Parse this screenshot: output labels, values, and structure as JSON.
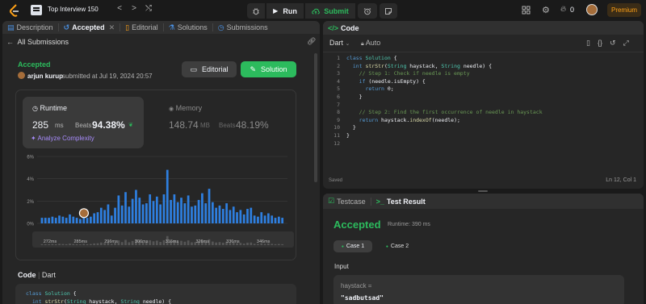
{
  "topbar": {
    "title": "Top Interview 150",
    "prev": "<",
    "next": ">",
    "shuffle": "⤭",
    "run": "Run",
    "submit": "Submit",
    "premium": "Premium",
    "fire_count": "0"
  },
  "left": {
    "tabs": [
      {
        "label": "Description"
      },
      {
        "label": "Accepted"
      },
      {
        "label": "Editorial"
      },
      {
        "label": "Solutions"
      },
      {
        "label": "Submissions"
      }
    ],
    "back": "All Submissions",
    "status": "Accepted",
    "user": "arjun kurup",
    "submitted": "submitted at Jul 19, 2024 20:57",
    "editorial_btn": "Editorial",
    "solution_btn": "Solution",
    "runtime": {
      "label": "Runtime",
      "value": "285",
      "unit": "ms",
      "beats": "Beats",
      "pct": "94.38%",
      "analyze": "Analyze Complexity"
    },
    "memory": {
      "label": "Memory",
      "value": "148.74",
      "unit": "MB",
      "beats": "Beats",
      "pct": "48.19%"
    },
    "code_label": "Code",
    "lang": "Dart",
    "code_preview": [
      "class Solution {",
      "  int strStr(String haystack, String needle) {"
    ]
  },
  "chart_data": {
    "type": "bar",
    "yticks": [
      "6%",
      "4%",
      "2%",
      "0%"
    ],
    "ylim": [
      0,
      6
    ],
    "x": [
      "272ms",
      "285ms",
      "296ms",
      "306ms",
      "316ms",
      "326ms",
      "336ms",
      "346ms"
    ],
    "values": [
      0.5,
      0.5,
      0.5,
      0.6,
      0.5,
      0.7,
      0.6,
      0.5,
      0.8,
      0.6,
      0.5,
      0.4,
      0.7,
      0.5,
      0.6,
      0.9,
      1.0,
      1.4,
      1.2,
      1.7,
      0.7,
      1.4,
      2.5,
      1.6,
      2.8,
      1.5,
      2.2,
      3.0,
      2.3,
      1.7,
      1.8,
      2.6,
      2.0,
      2.4,
      1.7,
      2.6,
      4.8,
      2.1,
      2.6,
      1.9,
      2.3,
      1.8,
      2.5,
      1.5,
      1.6,
      2.1,
      2.7,
      1.8,
      3.1,
      1.9,
      1.4,
      1.6,
      1.3,
      1.8,
      1.2,
      1.5,
      1.0,
      1.2,
      0.8,
      1.3,
      1.4,
      0.7,
      0.6,
      1.0,
      0.7,
      0.9,
      0.7,
      0.5,
      0.6,
      0.5
    ],
    "highlight_index": 12
  },
  "code": {
    "header": "Code",
    "lang": "Dart",
    "mode": "Auto",
    "saved": "Saved",
    "cursor": "Ln 12, Col 1",
    "lines": [
      [
        {
          "t": "class ",
          "c": "kw"
        },
        {
          "t": "Solution",
          "c": "ty"
        },
        {
          "t": " {",
          "c": ""
        }
      ],
      [
        {
          "t": "  int ",
          "c": "kw"
        },
        {
          "t": "strStr",
          "c": "fn"
        },
        {
          "t": "(",
          "c": ""
        },
        {
          "t": "String",
          "c": "ty"
        },
        {
          "t": " haystack, ",
          "c": ""
        },
        {
          "t": "String",
          "c": "ty"
        },
        {
          "t": " needle) {",
          "c": ""
        }
      ],
      [
        {
          "t": "    // Step 1: Check if needle is empty",
          "c": "cm"
        }
      ],
      [
        {
          "t": "    if",
          "c": "kw"
        },
        {
          "t": " (needle.isEmpty) {",
          "c": ""
        }
      ],
      [
        {
          "t": "      return",
          "c": "kw"
        },
        {
          "t": " 0;",
          "c": ""
        }
      ],
      [
        {
          "t": "    }",
          "c": ""
        }
      ],
      [
        {
          "t": "",
          "c": ""
        }
      ],
      [
        {
          "t": "    // Step 2: Find the first occurrence of needle in haystack",
          "c": "cm"
        }
      ],
      [
        {
          "t": "    return",
          "c": "kw"
        },
        {
          "t": " haystack.",
          "c": ""
        },
        {
          "t": "indexOf",
          "c": "fn"
        },
        {
          "t": "(needle);",
          "c": ""
        }
      ],
      [
        {
          "t": "  }",
          "c": ""
        }
      ],
      [
        {
          "t": "}",
          "c": ""
        }
      ],
      [
        {
          "t": "",
          "c": ""
        }
      ]
    ]
  },
  "result": {
    "tab1": "Testcase",
    "tab2": "Test Result",
    "status": "Accepted",
    "runtime": "Runtime: 390 ms",
    "case1": "Case 1",
    "case2": "Case 2",
    "input_label": "Input",
    "var": "haystack =",
    "val": "\"sadbutsad\""
  }
}
